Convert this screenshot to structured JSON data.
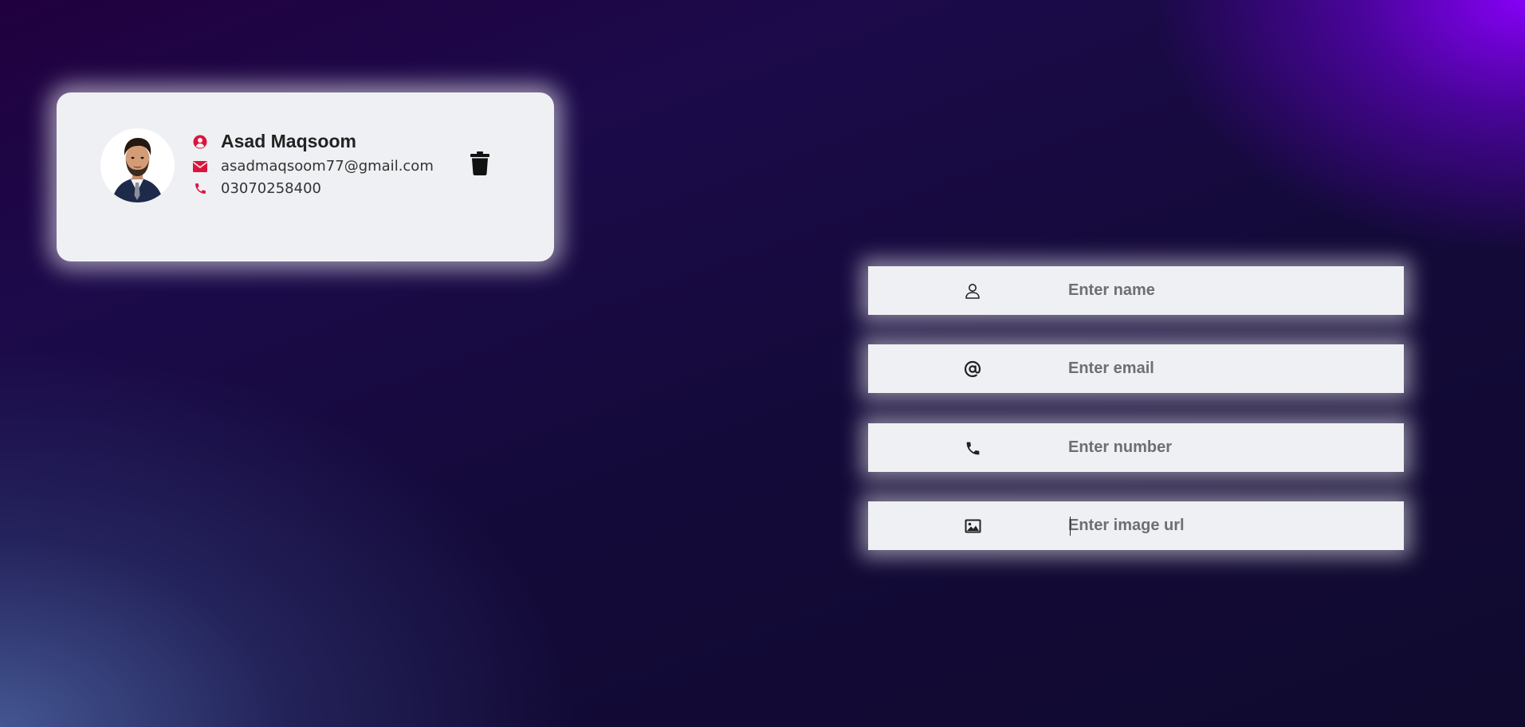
{
  "contact": {
    "name": "Asad Maqsoom",
    "email": "asadmaqsoom77@gmail.com",
    "phone": "03070258400",
    "avatar_icon": "profile-photo",
    "name_icon": "user-circle-icon",
    "email_icon": "envelope-icon",
    "phone_icon": "phone-icon",
    "delete_icon": "trash-icon",
    "accent_color": "#dc143c"
  },
  "form": {
    "name_placeholder": "Enter name",
    "email_placeholder": "Enter email",
    "number_placeholder": "Enter number",
    "image_placeholder": "Enter image url",
    "name_icon": "user-outline-icon",
    "email_icon": "at-sign-icon",
    "number_icon": "phone-icon",
    "image_icon": "image-icon"
  }
}
